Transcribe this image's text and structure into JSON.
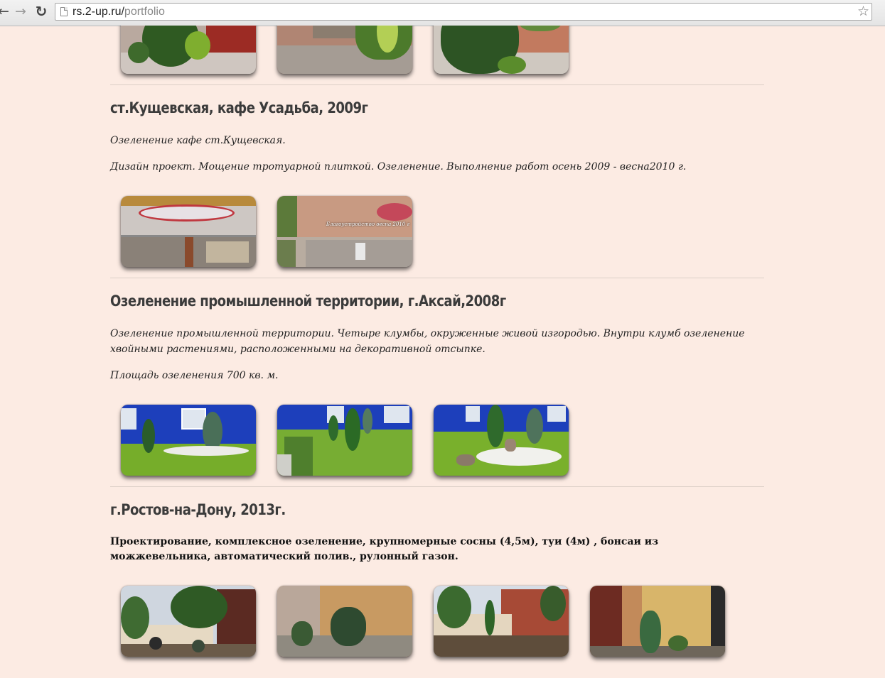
{
  "browser": {
    "back_glyph": "←",
    "forward_glyph": "→",
    "reload_glyph": "↻",
    "url_host": "rs.2-up.ru/",
    "url_path": "portfolio",
    "star_glyph": "☆"
  },
  "sections": [
    {
      "title": "ст.Кущевская, кафе Усадьба, 2009г",
      "paragraphs": [
        "Озеленение кафе ст.Кущевская.",
        "Дизайн проект. Мощение тротуарной плиткой. Озеленение. Выполнение работ осень 2009 - весна2010 г."
      ],
      "photo_caption": "Благоустройство весна 2010 г"
    },
    {
      "title": "Озеленение промышленной территории, г.Аксай,2008г",
      "paragraphs": [
        "Озеленение промышленной территории. Четыре клумбы, окруженные живой изгородью. Внутри клумб озеленение хвойными растениями, расположенными на декоративной отсыпке.",
        "Площадь озеленения 700 кв. м."
      ]
    },
    {
      "title": "г.Ростов-на-Дону, 2013г.",
      "paragraphs": [
        "Проектирование, комплексное озеленение, крупномерные сосны (4,5м), туи (4м) , бонсаи из можжевельника, автоматический полив., рулонный газон."
      ]
    }
  ],
  "colors": {
    "page_background": "#fcebe3",
    "heading": "#3b3b3b",
    "divider": "#dccfc7"
  },
  "icons": [
    "back-arrow-icon",
    "forward-arrow-icon",
    "reload-icon",
    "page-icon",
    "bookmark-star-icon"
  ]
}
